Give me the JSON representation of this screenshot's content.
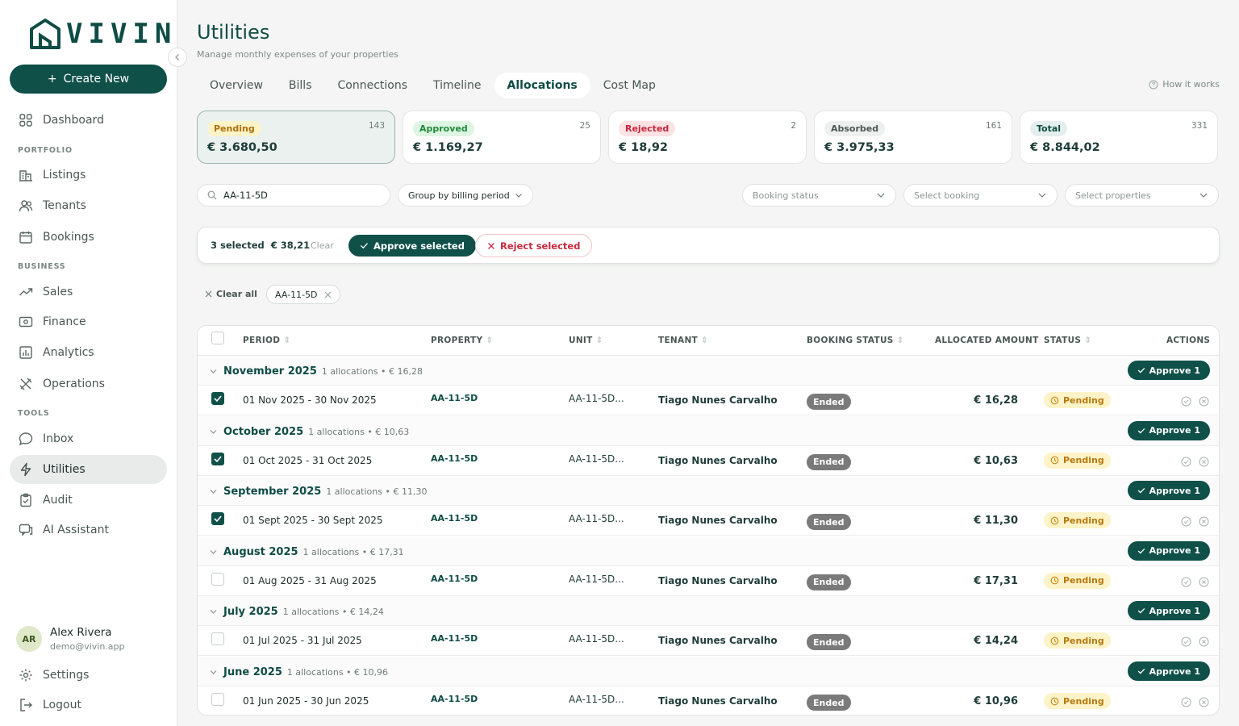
{
  "brand": {
    "name": "VIVIN"
  },
  "sidebar": {
    "create_label": "Create New",
    "sections": {
      "portfolio": "PORTFOLIO",
      "business": "BUSINESS",
      "tools": "TOOLS"
    },
    "items": {
      "dashboard": "Dashboard",
      "listings": "Listings",
      "tenants": "Tenants",
      "bookings": "Bookings",
      "sales": "Sales",
      "finance": "Finance",
      "analytics": "Analytics",
      "operations": "Operations",
      "inbox": "Inbox",
      "utilities": "Utilities",
      "audit": "Audit",
      "ai_assistant": "AI Assistant"
    },
    "user": {
      "initials": "AR",
      "name": "Alex Rivera",
      "email": "demo@vivin.app"
    },
    "settings": "Settings",
    "logout": "Logout"
  },
  "header": {
    "title": "Utilities",
    "subtitle": "Manage monthly expenses of your properties",
    "how_it_works": "How it works"
  },
  "tabs": [
    "Overview",
    "Bills",
    "Connections",
    "Timeline",
    "Allocations",
    "Cost Map"
  ],
  "cards": [
    {
      "label": "Pending",
      "count": "143",
      "amount": "€ 3.680,50"
    },
    {
      "label": "Approved",
      "count": "25",
      "amount": "€ 1.169,27"
    },
    {
      "label": "Rejected",
      "count": "2",
      "amount": "€ 18,92"
    },
    {
      "label": "Absorbed",
      "count": "161",
      "amount": "€ 3.975,33"
    },
    {
      "label": "Total",
      "count": "331",
      "amount": "€ 8.844,02"
    }
  ],
  "colors": {
    "accent": "#0f5049",
    "pending_bg": "#fdf3c8",
    "approved_bg": "#dff5e3",
    "rejected_bg": "#fde2e4"
  },
  "filters": {
    "search_value": "AA-11-5D",
    "group_by": "Group by billing period",
    "booking_status": "Booking status",
    "select_booking": "Select booking",
    "select_properties": "Select properties"
  },
  "bulk": {
    "selected": "3 selected",
    "amount": "€ 38,21",
    "clear": "Clear",
    "approve": "Approve selected",
    "reject": "Reject selected"
  },
  "chips": {
    "clear_all": "Clear all",
    "active": "AA-11-5D"
  },
  "table": {
    "headers": {
      "period": "PERIOD",
      "property": "PROPERTY",
      "unit": "UNIT",
      "tenant": "TENANT",
      "booking_status": "BOOKING STATUS",
      "allocated_amount": "ALLOCATED AMOUNT",
      "status": "STATUS",
      "actions": "ACTIONS"
    },
    "approve_label": "Approve 1",
    "groups": [
      {
        "title": "November 2025",
        "meta": "1 allocations • € 16,28",
        "period": "01 Nov 2025 - 30 Nov 2025",
        "property": "AA-11-5D",
        "unit": "AA-11-5D...",
        "tenant": "Tiago Nunes Carvalho",
        "booking_status": "Ended",
        "amount": "€ 16,28",
        "status": "Pending",
        "checked": true
      },
      {
        "title": "October 2025",
        "meta": "1 allocations • € 10,63",
        "period": "01 Oct 2025 - 31 Oct 2025",
        "property": "AA-11-5D",
        "unit": "AA-11-5D...",
        "tenant": "Tiago Nunes Carvalho",
        "booking_status": "Ended",
        "amount": "€ 10,63",
        "status": "Pending",
        "checked": true
      },
      {
        "title": "September 2025",
        "meta": "1 allocations • € 11,30",
        "period": "01 Sept 2025 - 30 Sept 2025",
        "property": "AA-11-5D",
        "unit": "AA-11-5D...",
        "tenant": "Tiago Nunes Carvalho",
        "booking_status": "Ended",
        "amount": "€ 11,30",
        "status": "Pending",
        "checked": true
      },
      {
        "title": "August 2025",
        "meta": "1 allocations • € 17,31",
        "period": "01 Aug 2025 - 31 Aug 2025",
        "property": "AA-11-5D",
        "unit": "AA-11-5D...",
        "tenant": "Tiago Nunes Carvalho",
        "booking_status": "Ended",
        "amount": "€ 17,31",
        "status": "Pending",
        "checked": false
      },
      {
        "title": "July 2025",
        "meta": "1 allocations • € 14,24",
        "period": "01 Jul 2025 - 31 Jul 2025",
        "property": "AA-11-5D",
        "unit": "AA-11-5D...",
        "tenant": "Tiago Nunes Carvalho",
        "booking_status": "Ended",
        "amount": "€ 14,24",
        "status": "Pending",
        "checked": false
      },
      {
        "title": "June 2025",
        "meta": "1 allocations • € 10,96",
        "period": "01 Jun 2025 - 30 Jun 2025",
        "property": "AA-11-5D",
        "unit": "AA-11-5D...",
        "tenant": "Tiago Nunes Carvalho",
        "booking_status": "Ended",
        "amount": "€ 10,96",
        "status": "Pending",
        "checked": false
      }
    ]
  }
}
